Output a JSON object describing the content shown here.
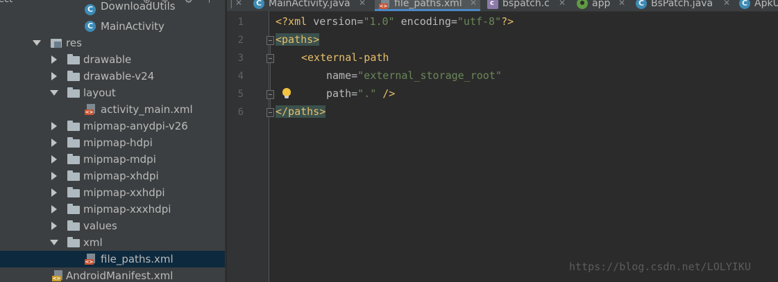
{
  "project_panel": {
    "header_title": "ect",
    "tree": [
      {
        "label": "DownloadUtils",
        "type": "class"
      },
      {
        "label": "MainActivity",
        "type": "class"
      },
      {
        "label": "res",
        "type": "res-folder",
        "state": "expanded"
      },
      {
        "label": "drawable",
        "type": "folder",
        "state": "collapsed"
      },
      {
        "label": "drawable-v24",
        "type": "folder",
        "state": "collapsed"
      },
      {
        "label": "layout",
        "type": "folder",
        "state": "expanded"
      },
      {
        "label": "activity_main.xml",
        "type": "xml"
      },
      {
        "label": "mipmap-anydpi-v26",
        "type": "folder",
        "state": "collapsed"
      },
      {
        "label": "mipmap-hdpi",
        "type": "folder",
        "state": "collapsed"
      },
      {
        "label": "mipmap-mdpi",
        "type": "folder",
        "state": "collapsed"
      },
      {
        "label": "mipmap-xhdpi",
        "type": "folder",
        "state": "collapsed"
      },
      {
        "label": "mipmap-xxhdpi",
        "type": "folder",
        "state": "collapsed"
      },
      {
        "label": "mipmap-xxxhdpi",
        "type": "folder",
        "state": "collapsed"
      },
      {
        "label": "values",
        "type": "folder",
        "state": "collapsed"
      },
      {
        "label": "xml",
        "type": "folder",
        "state": "expanded"
      },
      {
        "label": "file_paths.xml",
        "type": "xml",
        "selected": true
      },
      {
        "label": "AndroidManifest.xml",
        "type": "manifest"
      }
    ]
  },
  "tabs": [
    {
      "label": "MainActivity.java",
      "icon": "class-icon"
    },
    {
      "label": "file_paths.xml",
      "icon": "xml-file-icon",
      "active": true
    },
    {
      "label": "bspatch.c",
      "icon": "c-file-icon"
    },
    {
      "label": "app",
      "icon": "app-module-icon"
    },
    {
      "label": "BsPatch.java",
      "icon": "class-icon"
    },
    {
      "label": "ApkU",
      "icon": "class-icon"
    }
  ],
  "editor": {
    "line_numbers": [
      "1",
      "2",
      "3",
      "4",
      "5",
      "6"
    ],
    "code": {
      "l1_open": "<?xml ",
      "l1_attr1": "version=",
      "l1_val1": "\"1.0\"",
      "l1_attr2": " encoding=",
      "l1_val2": "\"utf-8\"",
      "l1_close": "?>",
      "l2_tag": "<paths>",
      "l3_tag": "<external-path",
      "l4_attr": "name=",
      "l4_val": "\"external_storage_root\"",
      "l5_attr": "path=",
      "l5_val": "\".\"",
      "l5_close": " />",
      "l6_tag": "</paths>"
    },
    "watermark": "https://blog.csdn.net/LOLYIKU"
  },
  "colors": {
    "tag": "#e8bf6a",
    "attribute": "#bababa",
    "value": "#6a8759",
    "selection": "#0d293e",
    "active_tab_underline": "#4a88c7"
  }
}
